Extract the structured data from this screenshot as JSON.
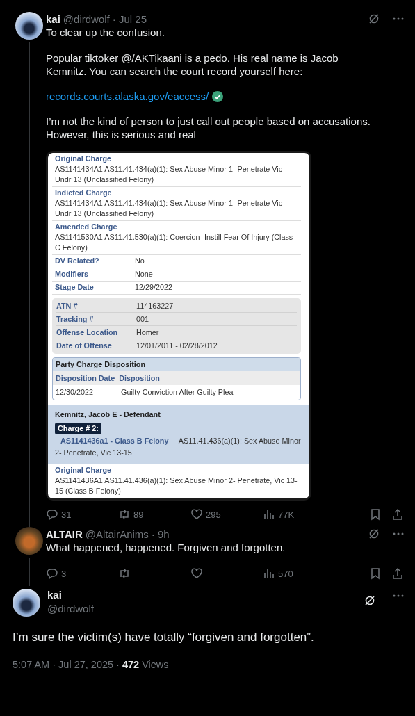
{
  "tweets": [
    {
      "kind": "reply",
      "name": "kai",
      "handle": "@dirdwolf",
      "time": "· Jul 25",
      "thread_below": true,
      "paragraphs": [
        "To clear up the confusion.",
        "Popular tiktoker @/AKTikaani is a pedo. His real name is Jacob Kemnitz. You can search the court record yourself here:"
      ],
      "link": "records.courts.alaska.gov/eaccess/",
      "paragraphs_after": [
        "I’m not the kind of person to just call out people based on accusations. However, this is serious and real"
      ],
      "document": {
        "sections": [
          {
            "kind": "charge",
            "label": "Original Charge",
            "text": "AS1141434A1 AS11.41.434(a)(1): Sex Abuse Minor 1- Penetrate Vic Undr 13 (Unclassified Felony)"
          },
          {
            "kind": "charge",
            "label": "Indicted Charge",
            "text": "AS1141434A1 AS11.41.434(a)(1): Sex Abuse Minor 1- Penetrate Vic Undr 13 (Unclassified Felony)"
          },
          {
            "kind": "charge",
            "label": "Amended Charge",
            "text": "AS1141530A1 AS11.41.530(a)(1): Coercion- Instill Fear Of Injury (Class C Felony)"
          },
          {
            "kind": "field",
            "label": "DV Related?",
            "value": "No"
          },
          {
            "kind": "field",
            "label": "Modifiers",
            "value": "None"
          },
          {
            "kind": "field",
            "label": "Stage Date",
            "value": "12/29/2022"
          },
          {
            "kind": "group",
            "fields": [
              {
                "label": "ATN #",
                "value": "114163227"
              },
              {
                "label": "Tracking #",
                "value": "001"
              },
              {
                "label": "Offense Location",
                "value": "Homer"
              },
              {
                "label": "Date of Offense",
                "value": "12/01/2011 - 02/28/2012"
              }
            ]
          },
          {
            "kind": "disposition",
            "title": "Party Charge Disposition",
            "headers": [
              "Disposition Date",
              "Disposition"
            ],
            "row": [
              "12/30/2022",
              "Guilty Conviction After Guilty Plea"
            ]
          },
          {
            "kind": "defendant",
            "name": "Kemnitz, Jacob E - Defendant",
            "badge": "Charge # 2:",
            "code": "AS1141436a1 - Class B Felony",
            "text": "AS11.41.436(a)(1): Sex Abuse Minor 2- Penetrate, Vic 13-15"
          },
          {
            "kind": "charge",
            "label": "Original Charge",
            "text": "AS1141436A1 AS11.41.436(a)(1): Sex Abuse Minor 2- Penetrate, Vic 13-15 (Class B Felony)"
          }
        ]
      },
      "stats": {
        "replies": "31",
        "reposts": "89",
        "likes": "295",
        "views": "77K"
      }
    },
    {
      "kind": "reply",
      "name": "ALTAIR",
      "handle": "@AltairAnims",
      "time": "· 9h",
      "thread_below": true,
      "paragraphs": [
        "What happened, happened. Forgiven and forgotten."
      ],
      "stats": {
        "replies": "3",
        "views": "570"
      }
    },
    {
      "kind": "main",
      "name": "kai",
      "handle": "@dirdwolf",
      "paragraphs": [
        "I’m sure the victim(s) have totally “forgiven and forgotten”."
      ],
      "footer": {
        "time": "5:07 AM · Jul 27, 2025 ·",
        "views": "472",
        "views_label": "Views"
      }
    }
  ]
}
